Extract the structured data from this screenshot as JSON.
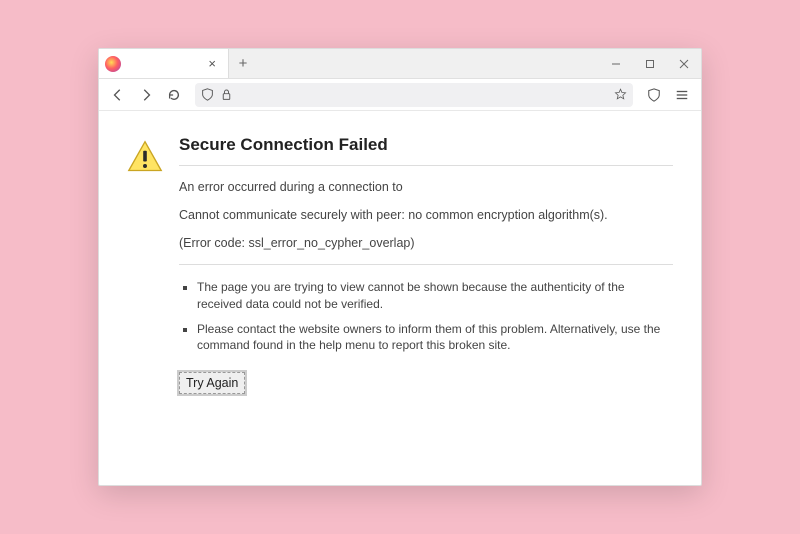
{
  "tab": {
    "title": "",
    "close_label": "×",
    "new_tab_label": "+"
  },
  "window_controls": {
    "minimize": "—",
    "maximize": "▢",
    "close": "×"
  },
  "error": {
    "title": "Secure Connection Failed",
    "line1": "An error occurred during a connection to",
    "line2": "Cannot communicate securely with peer: no common encryption algorithm(s).",
    "code": "(Error code: ssl_error_no_cypher_overlap)",
    "bullets": [
      "The page you are trying to view cannot be shown because the authenticity of the received data could not be verified.",
      "Please contact the website owners to inform them of this problem. Alternatively, use the command found in the help menu to report this broken site."
    ],
    "try_again": "Try Again"
  }
}
